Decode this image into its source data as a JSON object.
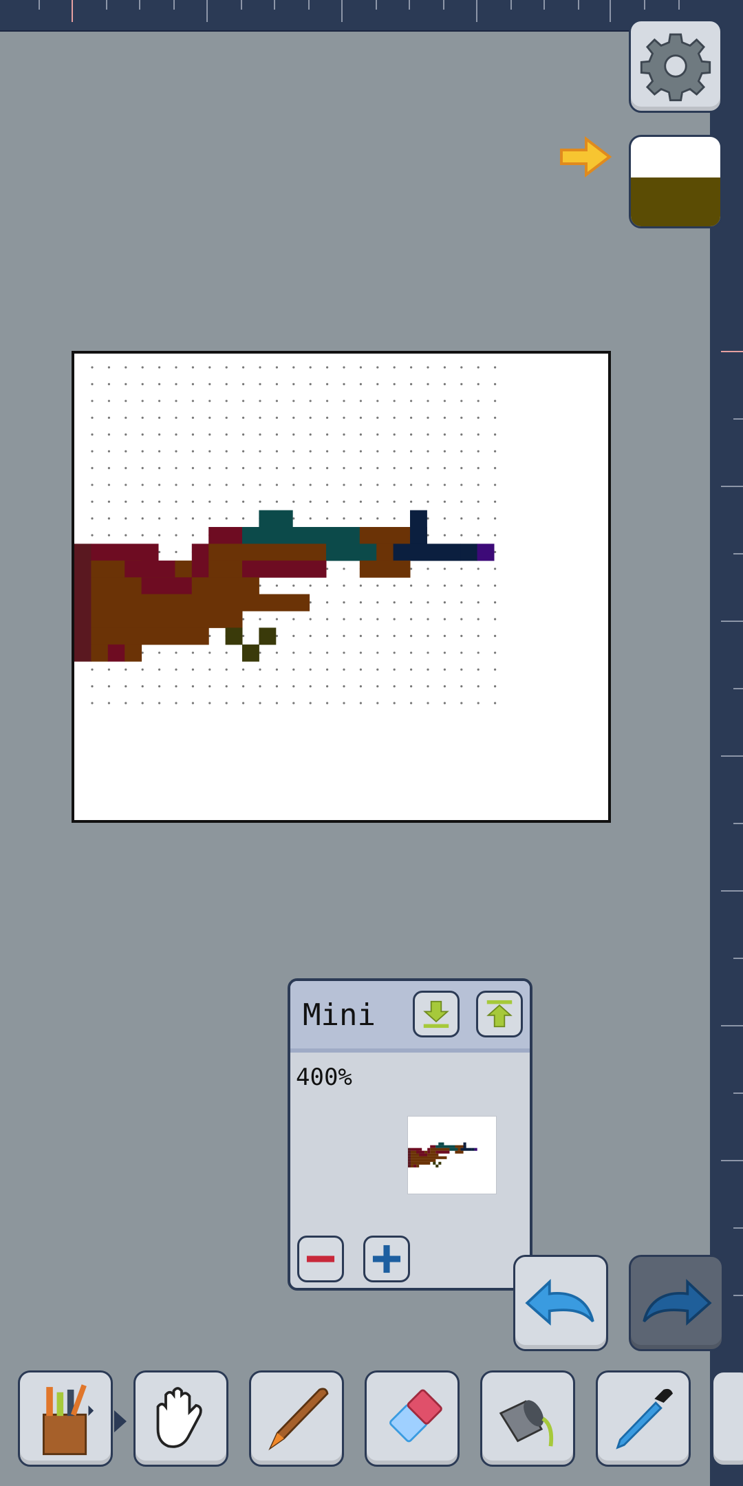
{
  "app": {
    "colors": {
      "background": "#8d969c",
      "ruler": "#2b3a55",
      "current_color": "#5b4c04"
    }
  },
  "mini_panel": {
    "title": "Mini",
    "zoom": "400%",
    "buttons": [
      "download-icon",
      "upload-icon",
      "minus-icon",
      "plus-icon"
    ]
  },
  "top_controls": {
    "icons": [
      "gear-icon",
      "arrow-right-icon",
      "color-swatch"
    ]
  },
  "history": {
    "icons": [
      "undo-icon",
      "redo-icon"
    ]
  },
  "toolbar": {
    "tools": [
      "palette-bucket-icon",
      "hand-icon",
      "brush-icon",
      "eraser-icon",
      "paint-bucket-icon",
      "eyedropper-icon"
    ]
  }
}
